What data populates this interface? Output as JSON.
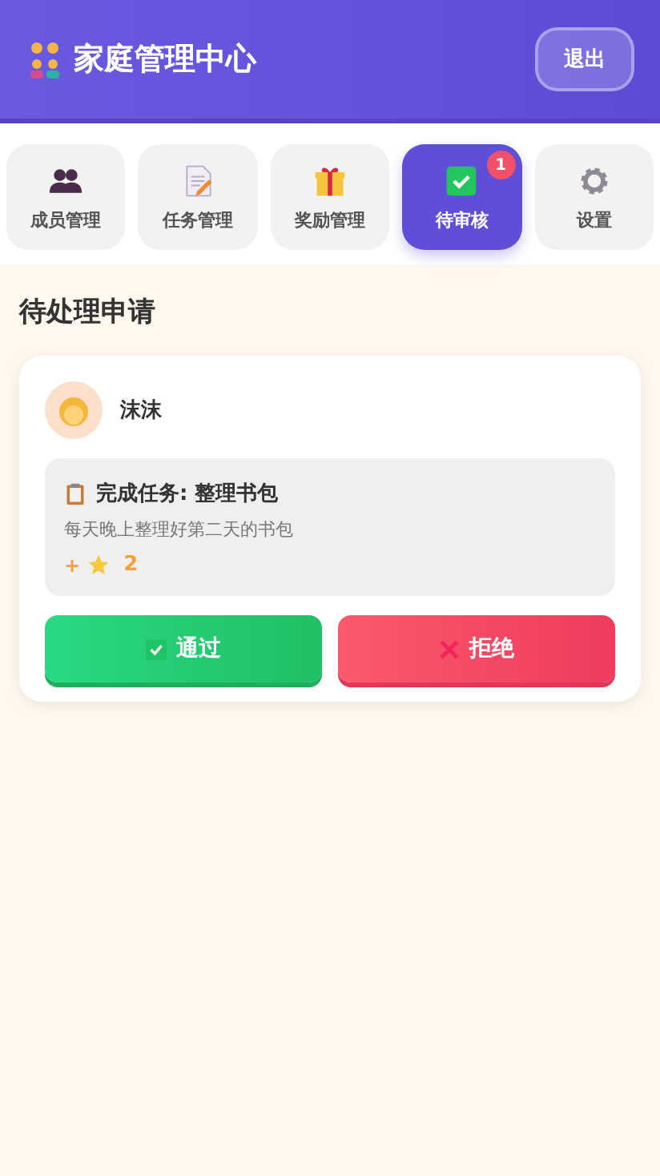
{
  "header": {
    "title": "家庭管理中心",
    "logout": "退出"
  },
  "tabs": [
    {
      "label": "成员管理",
      "selected": false
    },
    {
      "label": "任务管理",
      "selected": false
    },
    {
      "label": "奖励管理",
      "selected": false
    },
    {
      "label": "待审核",
      "selected": true,
      "badge": "1"
    },
    {
      "label": "设置",
      "selected": false
    }
  ],
  "section_title": "待处理申请",
  "requests": [
    {
      "member": "沫沫",
      "title": "完成任务: 整理书包",
      "description": "每天晚上整理好第二天的书包",
      "reward_prefix": "+",
      "reward_amount": "2",
      "approve": "通过",
      "reject": "拒绝"
    }
  ]
}
